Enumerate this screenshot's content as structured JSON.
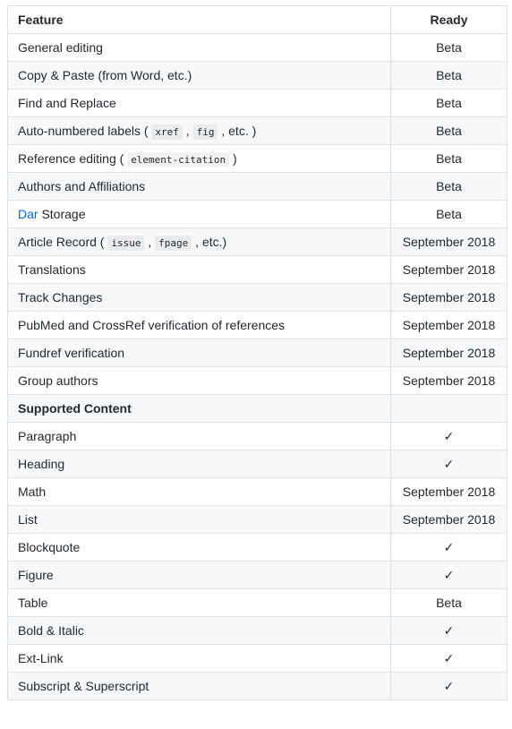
{
  "header": {
    "feature": "Feature",
    "ready": "Ready"
  },
  "rows": [
    {
      "label": "General editing",
      "ready": "Beta"
    },
    {
      "label": "Copy & Paste (from Word, etc.)",
      "ready": "Beta"
    },
    {
      "label": "Find and Replace",
      "ready": "Beta"
    },
    {
      "pre": "Auto-numbered labels ( ",
      "code1": "xref",
      "mid": " , ",
      "code2": "fig",
      "post": " , etc. )",
      "ready": "Beta"
    },
    {
      "pre": "Reference editing ( ",
      "code1": "element-citation",
      "post": " )",
      "ready": "Beta"
    },
    {
      "label": "Authors and Affiliations",
      "ready": "Beta"
    },
    {
      "link": "Dar",
      "post": " Storage",
      "ready": "Beta"
    },
    {
      "pre": "Article Record ( ",
      "code1": "issue",
      "mid": " , ",
      "code2": "fpage",
      "post": " , etc.)",
      "ready": "September 2018"
    },
    {
      "label": "Translations",
      "ready": "September 2018"
    },
    {
      "label": "Track Changes",
      "ready": "September 2018"
    },
    {
      "label": "PubMed and CrossRef verification of references",
      "ready": "September 2018"
    },
    {
      "label": "Fundref verification",
      "ready": "September 2018"
    },
    {
      "label": "Group authors",
      "ready": "September 2018"
    },
    {
      "label": "Supported Content",
      "ready": ""
    },
    {
      "label": "Paragraph",
      "ready": "✓"
    },
    {
      "label": "Heading",
      "ready": "✓"
    },
    {
      "label": "Math",
      "ready": "September 2018"
    },
    {
      "label": "List",
      "ready": "September 2018"
    },
    {
      "label": "Blockquote",
      "ready": "✓"
    },
    {
      "label": "Figure",
      "ready": "✓"
    },
    {
      "label": "Table",
      "ready": "Beta"
    },
    {
      "label": "Bold & Italic",
      "ready": "✓"
    },
    {
      "label": "Ext-Link",
      "ready": "✓"
    },
    {
      "label": "Subscript & Superscript",
      "ready": "✓"
    }
  ]
}
